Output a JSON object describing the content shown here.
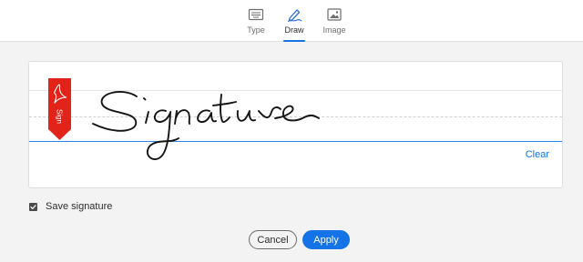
{
  "tabs": [
    {
      "label": "Type",
      "icon": "keyboard-icon",
      "active": false
    },
    {
      "label": "Draw",
      "icon": "pen-draw-icon",
      "active": true
    },
    {
      "label": "Image",
      "icon": "image-icon",
      "active": false
    }
  ],
  "canvas": {
    "clear_label": "Clear",
    "sign_tag_label": "Sign",
    "signature_text": "Signature"
  },
  "save_signature": {
    "label": "Save signature",
    "checked": true
  },
  "buttons": {
    "cancel": "Cancel",
    "apply": "Apply"
  },
  "colors": {
    "accent": "#1473e6",
    "tag_red": "#e2231a"
  }
}
